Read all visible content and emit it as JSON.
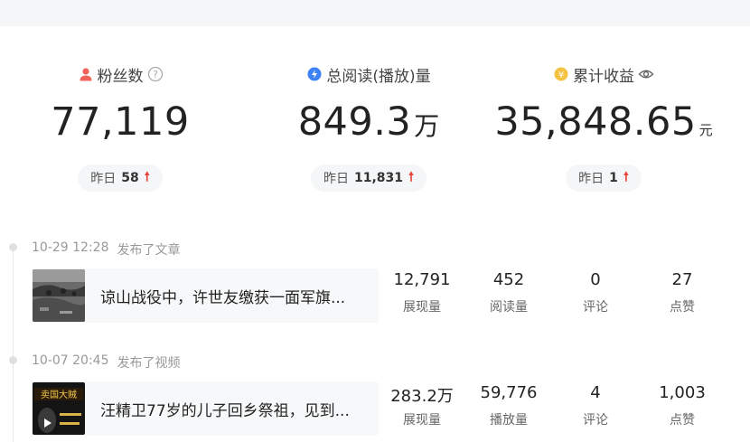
{
  "stats": {
    "fans": {
      "label": "粉丝数",
      "value": "77,119",
      "yday_label": "昨日",
      "yday_value": "58"
    },
    "reads": {
      "label": "总阅读(播放)量",
      "value": "849.3",
      "unit": "万",
      "yday_label": "昨日",
      "yday_value": "11,831"
    },
    "income": {
      "label": "累计收益",
      "value": "35,848.65",
      "unit": "元",
      "yday_label": "昨日",
      "yday_value": "1"
    }
  },
  "colors": {
    "fans_icon": "#f0625a",
    "reads_icon": "#3b82f6",
    "income_icon": "#f5c242",
    "up_arrow": "#e8453c"
  },
  "timeline": [
    {
      "time": "10-29 12:28",
      "action": "发布了文章",
      "title": "谅山战役中，许世友缴获一面军旗...",
      "metrics": [
        {
          "value": "12,791",
          "label": "展现量"
        },
        {
          "value": "452",
          "label": "阅读量"
        },
        {
          "value": "0",
          "label": "评论"
        },
        {
          "value": "27",
          "label": "点赞"
        }
      ]
    },
    {
      "time": "10-07 20:45",
      "action": "发布了视频",
      "title": "汪精卫77岁的儿子回乡祭祖，见到...",
      "thumb_text": "卖国大贼",
      "metrics": [
        {
          "value": "283.2万",
          "label": "展现量"
        },
        {
          "value": "59,776",
          "label": "播放量"
        },
        {
          "value": "4",
          "label": "评论"
        },
        {
          "value": "1,003",
          "label": "点赞"
        }
      ]
    }
  ]
}
